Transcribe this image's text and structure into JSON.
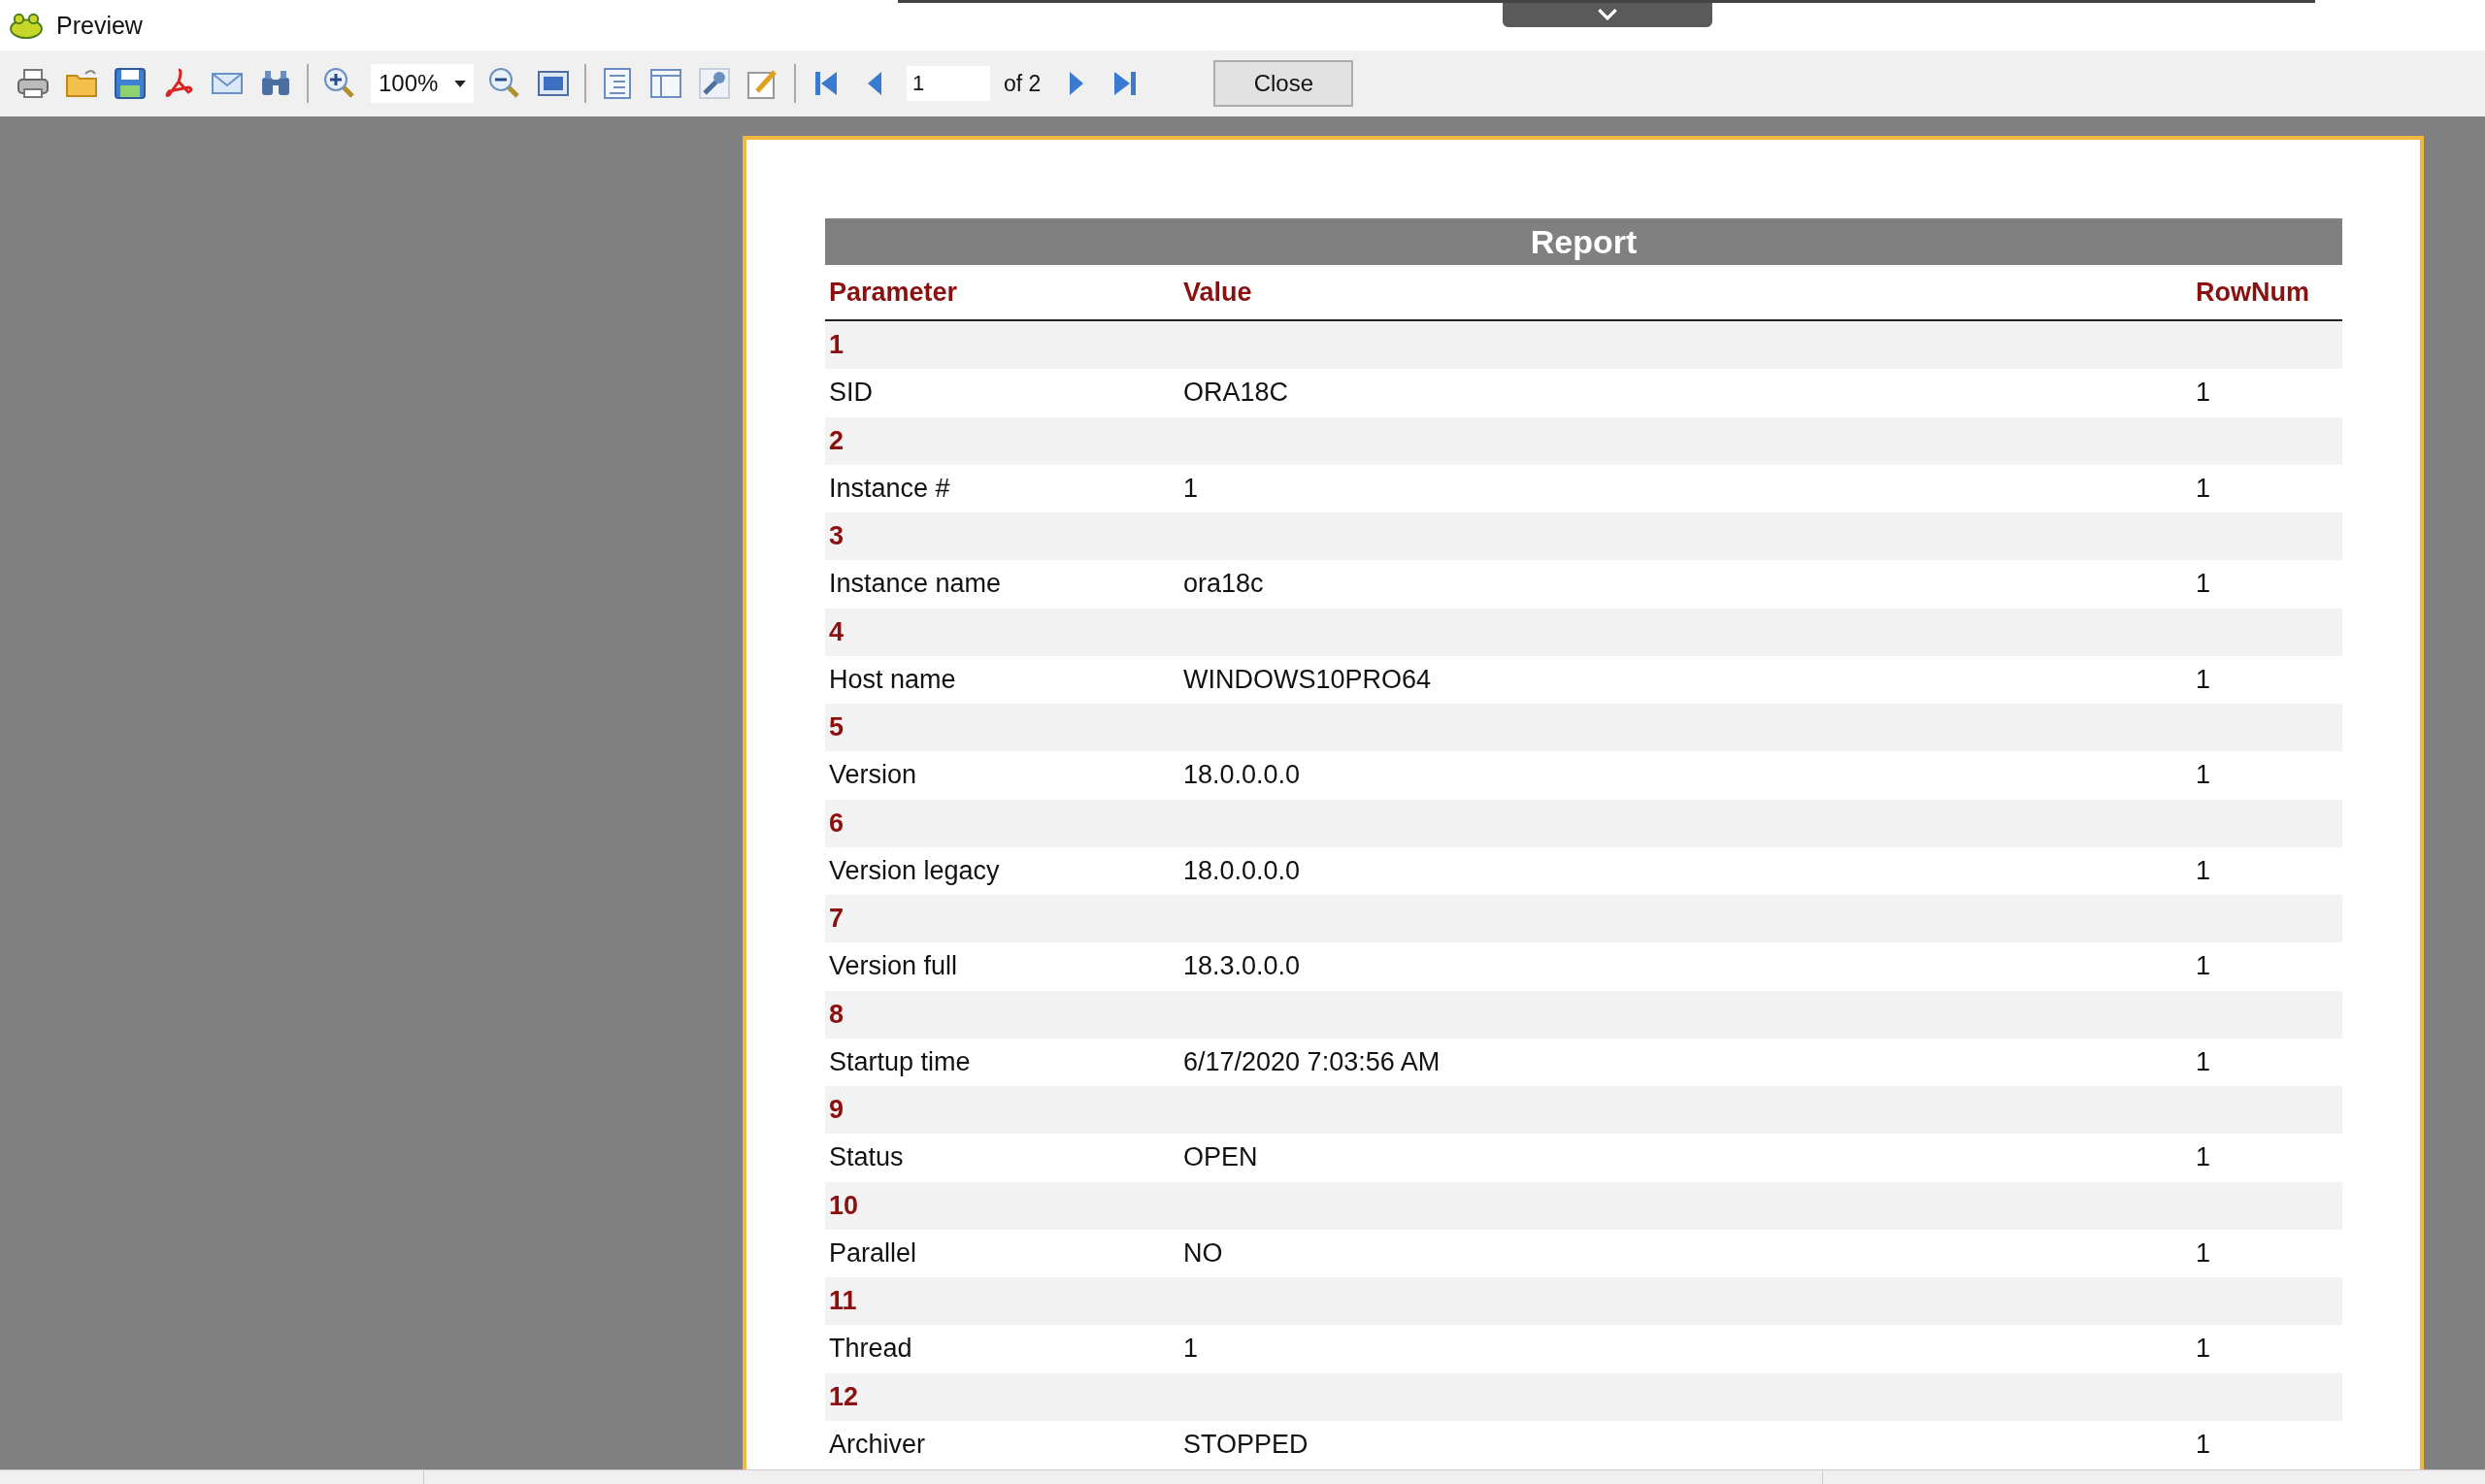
{
  "window": {
    "title": "Preview"
  },
  "toolbar": {
    "zoom": {
      "value": "100%"
    },
    "page": {
      "value": "1",
      "total": "of 2"
    },
    "close_button": "Close"
  },
  "report": {
    "title": "Report",
    "columns": [
      "Parameter",
      "Value",
      "RowNum"
    ],
    "groups": [
      {
        "number": "1",
        "rows": [
          {
            "parameter": "SID",
            "value": "ORA18C",
            "row_num": "1"
          }
        ]
      },
      {
        "number": "2",
        "rows": [
          {
            "parameter": "Instance #",
            "value": "1",
            "row_num": "1"
          }
        ]
      },
      {
        "number": "3",
        "rows": [
          {
            "parameter": "Instance name",
            "value": "ora18c",
            "row_num": "1"
          }
        ]
      },
      {
        "number": "4",
        "rows": [
          {
            "parameter": "Host name",
            "value": "WINDOWS10PRO64",
            "row_num": "1"
          }
        ]
      },
      {
        "number": "5",
        "rows": [
          {
            "parameter": "Version",
            "value": "18.0.0.0.0",
            "row_num": "1"
          }
        ]
      },
      {
        "number": "6",
        "rows": [
          {
            "parameter": "Version legacy",
            "value": "18.0.0.0.0",
            "row_num": "1"
          }
        ]
      },
      {
        "number": "7",
        "rows": [
          {
            "parameter": "Version full",
            "value": "18.3.0.0.0",
            "row_num": "1"
          }
        ]
      },
      {
        "number": "8",
        "rows": [
          {
            "parameter": "Startup time",
            "value": "6/17/2020 7:03:56 AM",
            "row_num": "1"
          }
        ]
      },
      {
        "number": "9",
        "rows": [
          {
            "parameter": "Status",
            "value": "OPEN",
            "row_num": "1"
          }
        ]
      },
      {
        "number": "10",
        "rows": [
          {
            "parameter": "Parallel",
            "value": "NO",
            "row_num": "1"
          }
        ]
      },
      {
        "number": "11",
        "rows": [
          {
            "parameter": "Thread",
            "value": "1",
            "row_num": "1"
          }
        ]
      },
      {
        "number": "12",
        "rows": [
          {
            "parameter": "Archiver",
            "value": "STOPPED",
            "row_num": "1"
          }
        ]
      }
    ]
  }
}
